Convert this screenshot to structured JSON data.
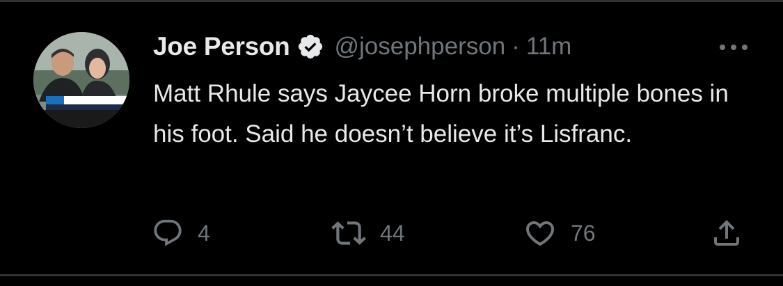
{
  "tweet": {
    "author_name": "Joe Person",
    "handle": "@josephperson",
    "separator": "·",
    "time": "11m",
    "text": "Matt Rhule says Jaycee Horn broke multiple bones in his foot. Said he doesn’t believe it’s Lisfranc.",
    "verified": true,
    "avatar_icon": "avatar-photo",
    "more_icon": "more-horizontal-icon"
  },
  "actions": {
    "reply_count": "4",
    "retweet_count": "44",
    "like_count": "76"
  },
  "colors": {
    "background": "#000000",
    "text_primary": "#e7e9ea",
    "text_secondary": "#71767b",
    "divider": "#2f3336"
  }
}
